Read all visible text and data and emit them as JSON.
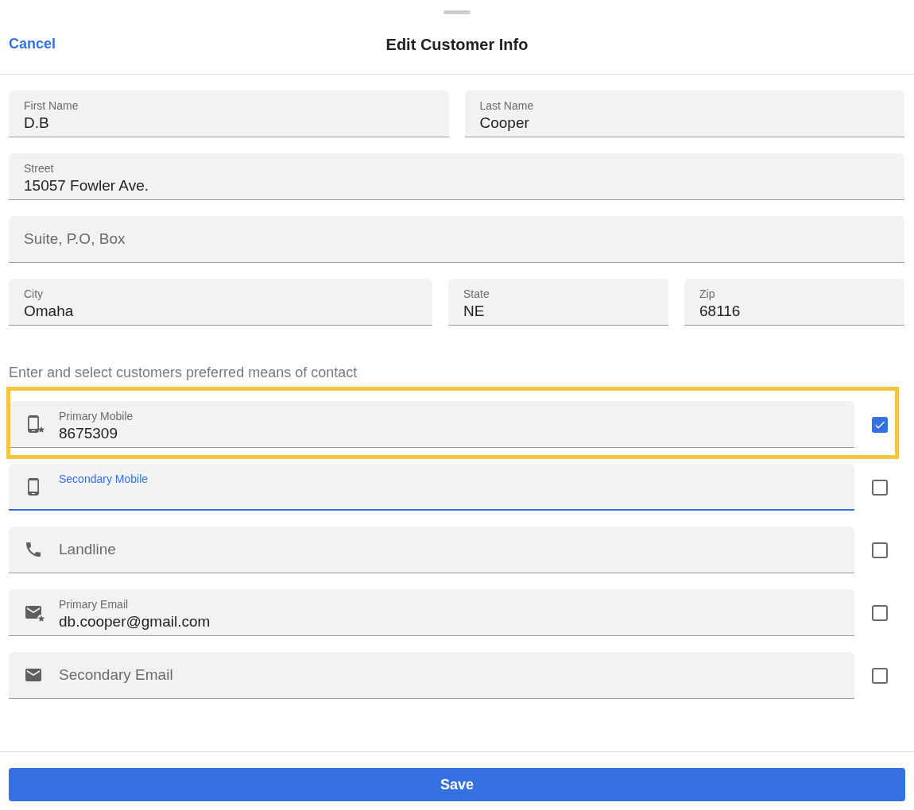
{
  "header": {
    "cancel": "Cancel",
    "title": "Edit Customer Info"
  },
  "address_rows": [
    [
      {
        "label": "First Name",
        "value": "D.B"
      },
      {
        "label": "Last Name",
        "value": "Cooper"
      }
    ],
    [
      {
        "label": "Street",
        "value": "15057 Fowler Ave."
      }
    ],
    [
      {
        "placeholder": "Suite, P.O, Box"
      }
    ],
    [
      {
        "label": "City",
        "value": "Omaha"
      },
      {
        "label": "State",
        "value": "NE"
      },
      {
        "label": "Zip",
        "value": "68116"
      }
    ]
  ],
  "contact_hint": "Enter and select customers preferred means of contact",
  "contacts": [
    {
      "kind": "mobile_primary",
      "label": "Primary Mobile",
      "value": "8675309",
      "checked": true,
      "focused": false,
      "highlighted": true
    },
    {
      "kind": "mobile",
      "label": "Secondary Mobile",
      "checked": false,
      "focused": true,
      "highlighted": false
    },
    {
      "kind": "landline",
      "placeholder": "Landline",
      "checked": false,
      "focused": false,
      "highlighted": false
    },
    {
      "kind": "email_primary",
      "label": "Primary Email",
      "value": "db.cooper@gmail.com",
      "checked": false,
      "focused": false,
      "highlighted": false
    },
    {
      "kind": "email",
      "placeholder": "Secondary Email",
      "checked": false,
      "focused": false,
      "highlighted": false
    }
  ],
  "save": "Save"
}
